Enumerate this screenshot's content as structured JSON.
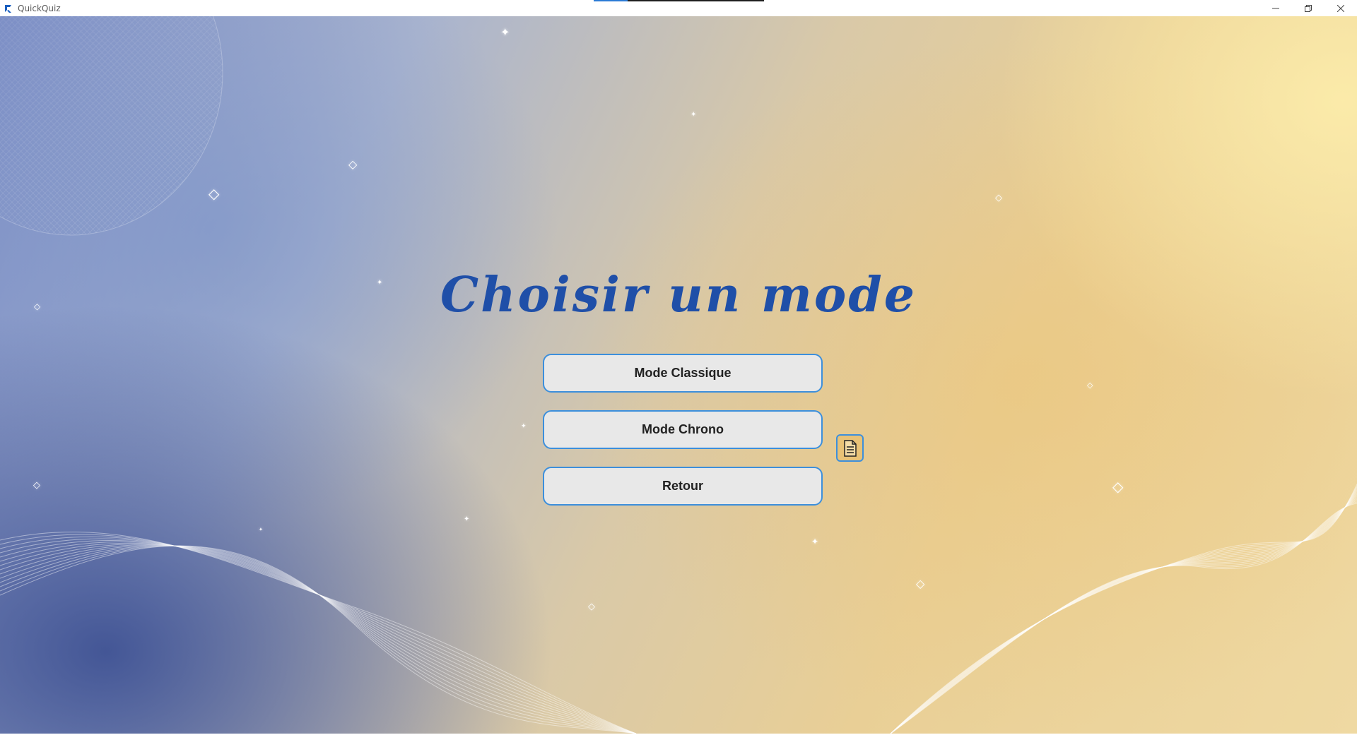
{
  "window": {
    "title": "QuickQuiz",
    "app_icon": "quickquiz-logo-icon",
    "progress": 0.2,
    "controls": [
      "minimize-icon",
      "restore-icon",
      "close-icon"
    ]
  },
  "screen": {
    "heading": "Choisir un mode",
    "buttons": {
      "classic": "Mode Classique",
      "chrono": "Mode Chrono",
      "back": "Retour"
    },
    "rules_icon": "document-icon"
  },
  "colors": {
    "heading": "#1f4fa8",
    "button_border": "#3c8fdc",
    "button_bg": "#e8e8e8",
    "rules_bg": "#e8c277"
  }
}
